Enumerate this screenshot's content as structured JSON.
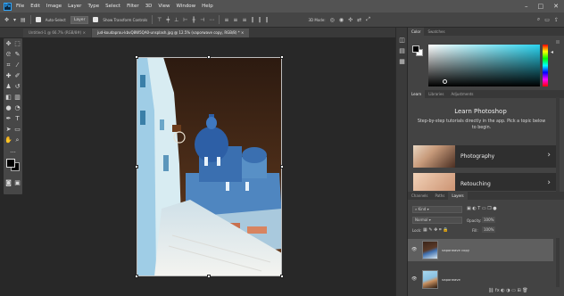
{
  "app_logo": "Ps",
  "menu": [
    "File",
    "Edit",
    "Image",
    "Layer",
    "Type",
    "Select",
    "Filter",
    "3D",
    "View",
    "Window",
    "Help"
  ],
  "options_bar": {
    "auto_select_label": "Auto-Select",
    "auto_select_value": "Layer",
    "show_transform_label": "Show Transform Controls",
    "mode_3d_label": "3D Mode:"
  },
  "tabs": [
    {
      "label": "Untitled-1 @ 66.7% (RGB/8#)",
      "active": false
    },
    {
      "label": "jud-koudaprou-kbvQ8W5QA0-unsplash.jpg @ 12.5% (vaporwave copy, RGB/8) *",
      "active": true
    }
  ],
  "color_panel": {
    "tabs": [
      "Color",
      "Swatches"
    ]
  },
  "learn_panel": {
    "tabs": [
      "Learn",
      "Libraries",
      "Adjustments"
    ],
    "title": "Learn Photoshop",
    "desc": "Step-by-step tutorials directly in the app. Pick a topic below to begin.",
    "cards": [
      "Photography",
      "Retouching"
    ]
  },
  "layers_panel": {
    "tabs": [
      "Channels",
      "Paths",
      "Layers"
    ],
    "filter_label": "Kind",
    "blend_mode": "Normal",
    "opacity_label": "Opacity:",
    "opacity_value": "100%",
    "lock_label": "Lock:",
    "fill_label": "Fill:",
    "fill_value": "100%",
    "layers": [
      "vaporwave copy",
      "vaporwave"
    ]
  },
  "colors": {
    "accent": "#31a8ff",
    "canvas_bg": "#282828",
    "panel_bg": "#434343"
  }
}
